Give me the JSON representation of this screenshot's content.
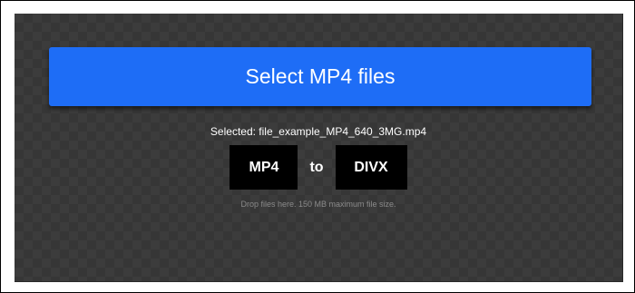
{
  "upload": {
    "select_label": "Select MP4 files",
    "selected_text": "Selected: file_example_MP4_640_3MG.mp4",
    "drop_hint": "Drop files here. 150 MB maximum file size."
  },
  "conversion": {
    "from_format": "MP4",
    "to_label": "to",
    "to_format": "DIVX"
  },
  "colors": {
    "button": "#1e6df6",
    "panel": "#3c3c3c",
    "format_box": "#000000"
  }
}
